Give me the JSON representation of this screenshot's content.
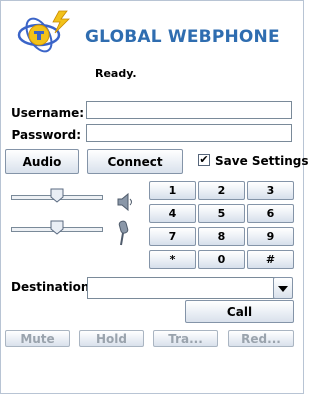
{
  "app": {
    "title": "GLOBAL WEBPHONE",
    "status": "Ready."
  },
  "login": {
    "username_label": "Username:",
    "username_value": "",
    "password_label": "Password:",
    "password_value": ""
  },
  "actions": {
    "audio": "Audio",
    "connect": "Connect",
    "save_settings": "Save Settings",
    "save_checked": "✔"
  },
  "volume": {
    "speaker_level": 0.5,
    "mic_level": 0.5
  },
  "keypad": [
    "1",
    "2",
    "3",
    "4",
    "5",
    "6",
    "7",
    "8",
    "9",
    "*",
    "0",
    "#"
  ],
  "destination": {
    "label": "Destination:",
    "value": "",
    "call": "Call"
  },
  "controls": {
    "mute": "Mute",
    "hold": "Hold",
    "transfer": "Tra...",
    "redial": "Red..."
  },
  "colors": {
    "title": "#2f6db0",
    "accent_yellow": "#f2c21a",
    "logo_blue": "#3a64c8"
  },
  "icons": {
    "speaker": "speaker-icon",
    "microphone": "microphone-icon",
    "dropdown": "chevron-down-icon",
    "logo": "globe-phone-logo-icon"
  }
}
